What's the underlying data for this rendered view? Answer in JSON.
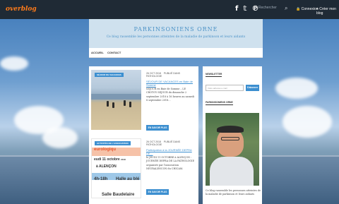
{
  "topbar": {
    "logo": "overblog",
    "social_icons": [
      "facebook-icon",
      "twitter-icon",
      "pinterest-icon"
    ],
    "search_placeholder": "Rechercher",
    "connexion": "Connexion",
    "create_blog": "+ Créer mon blog"
  },
  "header": {
    "title": "PARKINSONIENS ORNE",
    "subtitle": "Ce blog rassemble les personnes atteintes de la maladie de parkinson et leurs aidants"
  },
  "nav": {
    "items": [
      "ACCUEIL",
      "CONTACT"
    ]
  },
  "posts": [
    {
      "tag": "SÉJOUR DE VACANCES",
      "date": "26 OCT 2018",
      "author": "PUBLIÉ DANS PATHOLOGIE",
      "title": "SÉJOUR DE VACANCES en Baie de Somme",
      "excerpt": "SEJOUR en Baie de Somme – LE CROTOY SEJOUR du dimanche 2 septembre 2018 à 16 heures au samedi 8 septembre 2018…",
      "button": "EN SAVOIR PLUS"
    },
    {
      "tag": "ACTIVITÉS DE L'ASSOCIATION",
      "date": "26 OCT 2018",
      "author": "PUBLIÉ DANS PATHOLOGIE",
      "title": "Participation à la JOURNÉE DEPRA DE…",
      "excerpt": "le JEUDI 11 OCTOBRE à ALENÇON : JOURNÉE DEPRA DE LA PATHOLOGIE organisée par l'association NEURALENCON du CHICAM.",
      "button": "EN SAVOIR PLUS",
      "poster": {
        "line1": "eurologiqu",
        "line2": "eudi 11 octobre",
        "year": "2018",
        "line3": "à ALENÇON",
        "line4": "4h-18h",
        "line5": "Halle au blé",
        "line6": "Salle Baudelaire"
      }
    }
  ],
  "sidebar": {
    "newsletter_title": "NEWSLETTER",
    "newsletter_placeholder": "Votre adresse e-mail",
    "newsletter_button": "S'abonner",
    "about_title": "PARKINSONIENS ORNE",
    "bio": "Ce blog rassemble les personnes atteintes de la maladie de parkinson et leurs aidants"
  }
}
